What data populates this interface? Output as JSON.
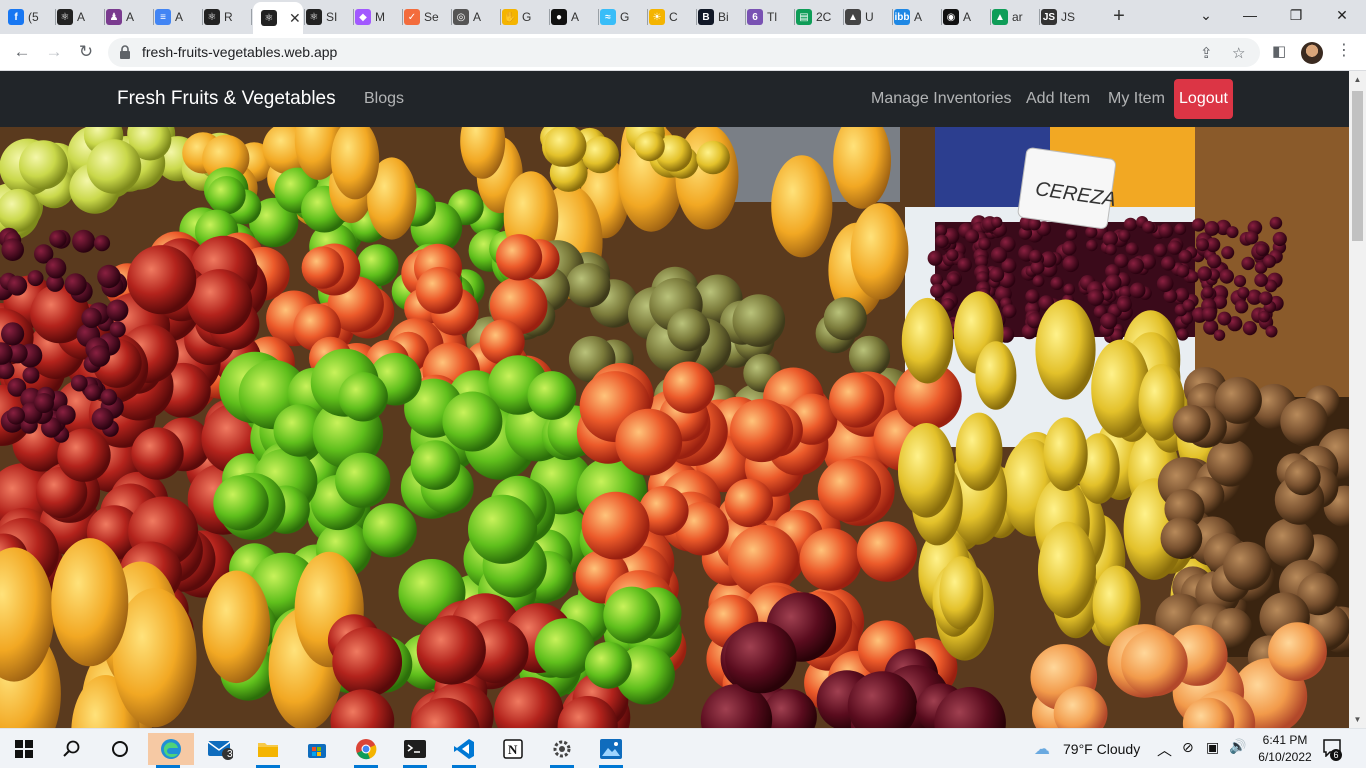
{
  "browser": {
    "tabs": [
      {
        "label": "(5",
        "icon": "facebook-icon",
        "color": "#1877f2",
        "glyph": "f"
      },
      {
        "label": "A",
        "icon": "react-icon",
        "color": "#222",
        "glyph": "⚛"
      },
      {
        "label": "A",
        "icon": "avatar-icon",
        "color": "#7a3b8f",
        "glyph": "♟"
      },
      {
        "label": "A",
        "icon": "docs-icon",
        "color": "#4285f4",
        "glyph": "≡"
      },
      {
        "label": "R",
        "icon": "react-icon",
        "color": "#222",
        "glyph": "⚛"
      },
      {
        "label": "",
        "icon": "react-icon",
        "color": "#222",
        "glyph": "⚛",
        "active": true
      },
      {
        "label": "SI",
        "icon": "react-icon",
        "color": "#222",
        "glyph": "⚛"
      },
      {
        "label": "M",
        "icon": "figma-icon",
        "color": "#a259ff",
        "glyph": "◆"
      },
      {
        "label": "Se",
        "icon": "search-engine-icon",
        "color": "#f36c3d",
        "glyph": "✓"
      },
      {
        "label": "A",
        "icon": "globe-icon",
        "color": "#555",
        "glyph": "◎"
      },
      {
        "label": "G",
        "icon": "hand-icon",
        "color": "#f4b400",
        "glyph": "✋"
      },
      {
        "label": "A",
        "icon": "github-icon",
        "color": "#111",
        "glyph": "●"
      },
      {
        "label": "G",
        "icon": "tailwind-icon",
        "color": "#38bdf8",
        "glyph": "≈"
      },
      {
        "label": "C",
        "icon": "sun-icon",
        "color": "#f4b400",
        "glyph": "☀"
      },
      {
        "label": "Bi",
        "icon": "bootstrap-icon",
        "color": "#111827",
        "glyph": "B"
      },
      {
        "label": "Tl",
        "icon": "six-icon",
        "color": "#7952b3",
        "glyph": "6"
      },
      {
        "label": "2C",
        "icon": "calendar-icon",
        "color": "#0f9d58",
        "glyph": "▤"
      },
      {
        "label": "U",
        "icon": "graduation-icon",
        "color": "#444",
        "glyph": "▲"
      },
      {
        "label": "A",
        "icon": "imgbb-icon",
        "color": "#1e88e5",
        "glyph": "ibb"
      },
      {
        "label": "A",
        "icon": "app-icon",
        "color": "#111",
        "glyph": "◉"
      },
      {
        "label": "ar",
        "icon": "drive-icon",
        "color": "#0f9d58",
        "glyph": "▲"
      },
      {
        "label": "JS",
        "icon": "js-icon",
        "color": "#333",
        "glyph": "JS"
      }
    ],
    "url": "fresh-fruits-vegetables.web.app"
  },
  "site": {
    "brand": "Fresh Fruits & Vegetables",
    "nav_left": [
      "Blogs"
    ],
    "nav_right": [
      "Manage Inventories",
      "Add Item",
      "My Item"
    ],
    "logout_label": "Logout",
    "accent": "#dc3545",
    "navbar_color": "#212529"
  },
  "taskbar": {
    "apps": [
      "windows-start-icon",
      "search-icon",
      "task-view-icon",
      "edge-icon",
      "mail-icon",
      "file-explorer-icon",
      "store-icon",
      "chrome-icon",
      "terminal-icon",
      "vscode-icon",
      "notion-icon",
      "settings-icon",
      "photos-icon"
    ],
    "mail_badge": "3",
    "weather": "79°F  Cloudy",
    "time": "6:41 PM",
    "date": "6/10/2022",
    "notifications": "6"
  }
}
